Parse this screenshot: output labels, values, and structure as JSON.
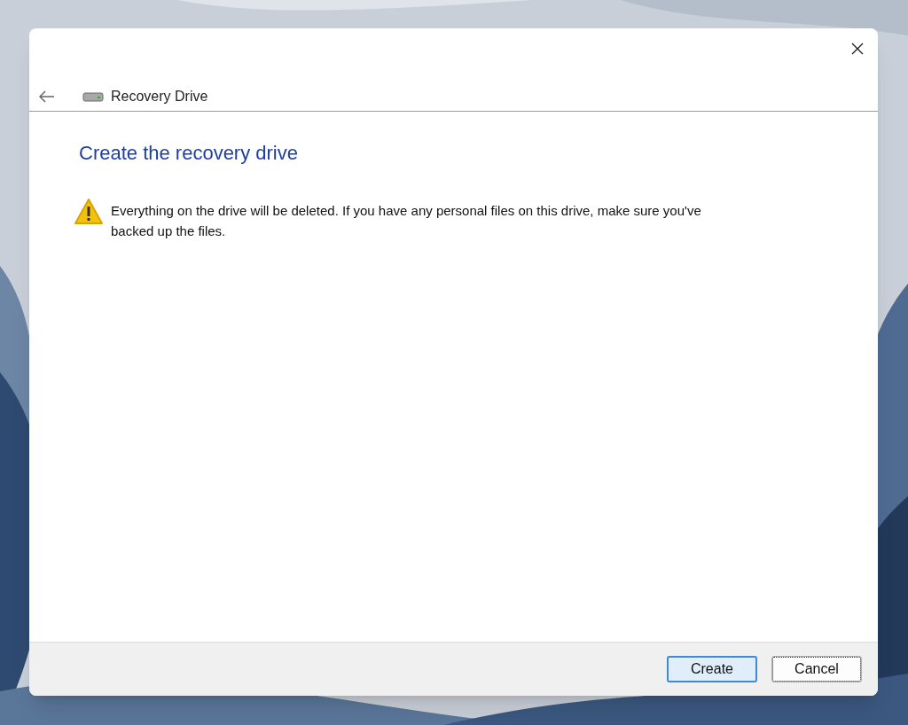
{
  "window": {
    "title": "Recovery Drive"
  },
  "heading": "Create the recovery drive",
  "warning": "Everything on the drive will be deleted. If you have any personal files on this drive, make sure you've backed up the files.",
  "buttons": [
    {
      "label": "Create",
      "default": true,
      "focused": false
    },
    {
      "label": "Cancel",
      "default": false,
      "focused": true
    }
  ]
}
